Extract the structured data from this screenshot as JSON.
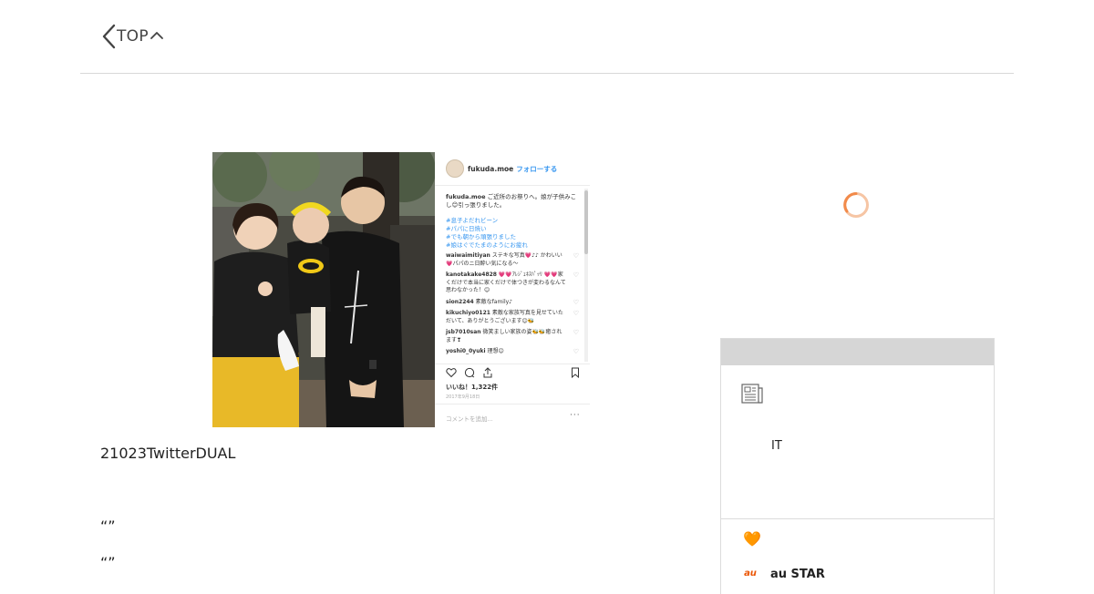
{
  "header": {
    "back_label": "TOP"
  },
  "instagram": {
    "handle": "fukuda.moe",
    "follow": "フォローする",
    "caption_user": "fukuda.moe",
    "caption_text": "ご近所のお祭りへ。娘が子供みこし😊引っ張りました。",
    "hashtags": [
      "#息子よだれビーン",
      "#パパに日焼い",
      "#でも朝から頑張りました",
      "#娘はぐでたまのようにお疲れ"
    ],
    "comments": [
      {
        "user": "waiwaimitiyan",
        "text": "ステキな写真💗♪♪ かわいい💗パパのニ日酔い気になる〜"
      },
      {
        "user": "kanotakake4828",
        "text": "💗💗ｱﾚｼﾞｪﾈｽﾊﾟｯﾘ 💗💗家くだけで本当に家くだけで体つきが変わるなんて思わなかった！😊"
      },
      {
        "user": "sion2244",
        "text": "素敵なfamily♪"
      },
      {
        "user": "kikuchiyo0121",
        "text": "素敵な家族写真を見せていただいて、ありがとうございます😊🐝"
      },
      {
        "user": "jsb7010san",
        "text": "微笑ましい家族の姿🐝🐝癒されます❣"
      },
      {
        "user": "yoshi0_0yuki",
        "text": "理想😊"
      }
    ],
    "likes": "いいね！1,322件",
    "date": "2017年9月18日",
    "add_comment": "コメントを追加...",
    "more": "···"
  },
  "article": {
    "paragraph_1": "21023TwitterDUAL",
    "quote_1": "“”",
    "quote_2": "“”"
  },
  "sidebar": {
    "card_text": "IT",
    "heart": "🧡",
    "au_logo": "au",
    "brand": "au STAR"
  },
  "colors": {
    "accent_orange": "#f07a2c",
    "spinner": "#f28a4a",
    "instagram_blue": "#3897f0"
  }
}
